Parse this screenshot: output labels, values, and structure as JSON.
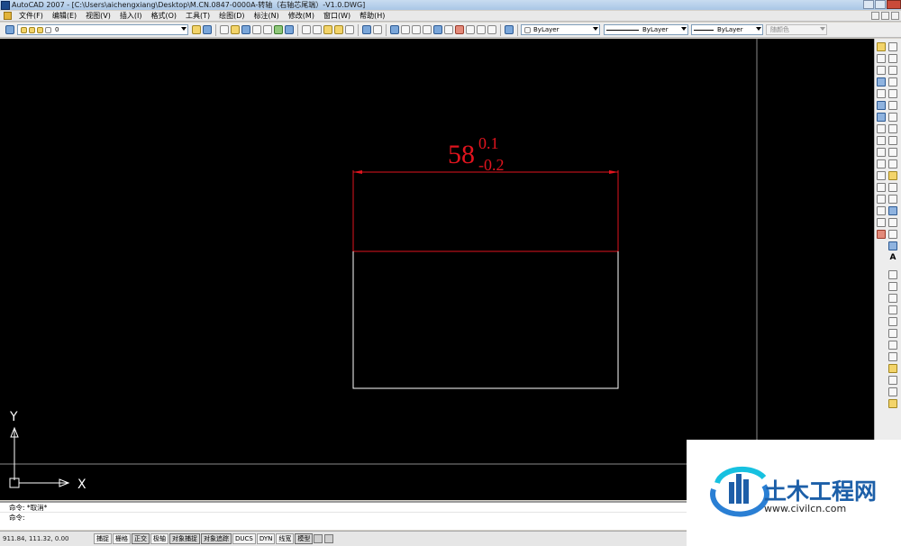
{
  "window": {
    "title": "AutoCAD 2007 - [C:\\Users\\aichengxiang\\Desktop\\M.CN.0847-0000A-转轴（右轴芯尾端）-V1.0.DWG]"
  },
  "menu": {
    "items": [
      "文件(F)",
      "编辑(E)",
      "视图(V)",
      "插入(I)",
      "格式(O)",
      "工具(T)",
      "绘图(D)",
      "标注(N)",
      "修改(M)",
      "窗口(W)",
      "帮助(H)"
    ]
  },
  "toolbar": {
    "layer_value": "0",
    "color_value": "ByLayer",
    "linetype_value": "ByLayer",
    "lineweight_value": "ByLayer",
    "plotstyle_value": "随颜色"
  },
  "drawing": {
    "dimension_value": "58",
    "upper_tolerance": "0.1",
    "lower_tolerance": "-0.2",
    "ucs_x_label": "X",
    "ucs_y_label": "Y",
    "colors": {
      "background": "#000000",
      "dimension": "#e0141e",
      "geometry": "#ffffff"
    }
  },
  "command": {
    "history": "命令: *取消*",
    "prompt": "命令:"
  },
  "status": {
    "coordinates": "911.84, 111.32, 0.00",
    "buttons": [
      "捕捉",
      "栅格",
      "正交",
      "极轴",
      "对象捕捉",
      "对象追踪",
      "DUCS",
      "DYN",
      "线宽",
      "模型"
    ]
  },
  "watermark": {
    "brand": "土木工程网",
    "url": "www.civilcn.com"
  }
}
